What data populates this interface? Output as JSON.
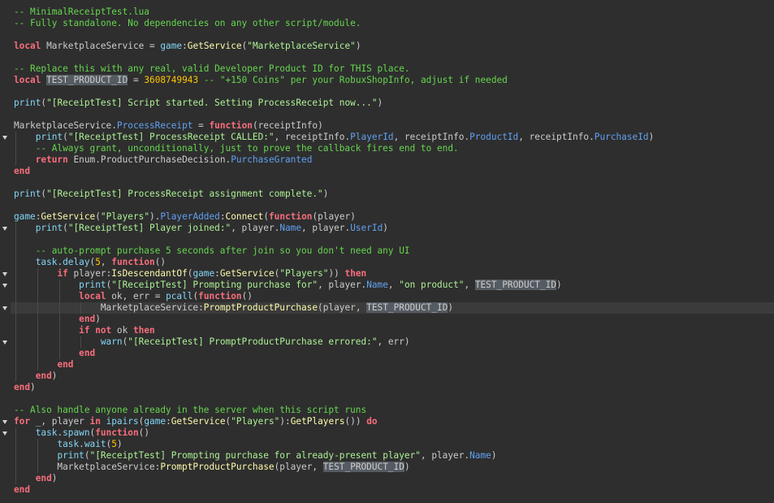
{
  "editor": {
    "language": "lua",
    "current_line_index": 26,
    "fold_markers": [
      11,
      19,
      23,
      24,
      26,
      29,
      36,
      37
    ],
    "lines": [
      [
        [
          "cm",
          "-- MinimalReceiptTest.lua"
        ]
      ],
      [
        [
          "cm",
          "-- Fully standalone. No dependencies on any other script/module."
        ]
      ],
      [],
      [
        [
          "kw",
          "local"
        ],
        [
          "id",
          " MarketplaceService "
        ],
        [
          "op",
          "="
        ],
        [
          "id",
          " "
        ],
        [
          "bi",
          "game"
        ],
        [
          "op",
          ":"
        ],
        [
          "fn",
          "GetService"
        ],
        [
          "op",
          "("
        ],
        [
          "st",
          "\"MarketplaceService\""
        ],
        [
          "op",
          ")"
        ]
      ],
      [],
      [
        [
          "cm",
          "-- Replace this with any real, valid Developer Product ID for THIS place."
        ]
      ],
      [
        [
          "kw",
          "local"
        ],
        [
          "id",
          " "
        ],
        [
          "hl",
          "TEST_PRODUCT_ID"
        ],
        [
          "id",
          " "
        ],
        [
          "op",
          "="
        ],
        [
          "id",
          " "
        ],
        [
          "nm",
          "3608749943"
        ],
        [
          "id",
          " "
        ],
        [
          "cm",
          "-- \"+150 Coins\" per your RobuxShopInfo, adjust if needed"
        ]
      ],
      [],
      [
        [
          "bi",
          "print"
        ],
        [
          "op",
          "("
        ],
        [
          "st",
          "\"[ReceiptTest] Script started. Setting ProcessReceipt now...\""
        ],
        [
          "op",
          ")"
        ]
      ],
      [],
      [
        [
          "id",
          "MarketplaceService"
        ],
        [
          "op",
          "."
        ],
        [
          "pr",
          "ProcessReceipt"
        ],
        [
          "id",
          " "
        ],
        [
          "op",
          "="
        ],
        [
          "id",
          " "
        ],
        [
          "kw",
          "function"
        ],
        [
          "op",
          "("
        ],
        [
          "id",
          "receiptInfo"
        ],
        [
          "op",
          ")"
        ]
      ],
      [
        [
          "id",
          "    "
        ],
        [
          "bi",
          "print"
        ],
        [
          "op",
          "("
        ],
        [
          "st",
          "\"[ReceiptTest] ProcessReceipt CALLED:\""
        ],
        [
          "op",
          ","
        ],
        [
          "id",
          " receiptInfo"
        ],
        [
          "op",
          "."
        ],
        [
          "pr",
          "PlayerId"
        ],
        [
          "op",
          ","
        ],
        [
          "id",
          " receiptInfo"
        ],
        [
          "op",
          "."
        ],
        [
          "pr",
          "ProductId"
        ],
        [
          "op",
          ","
        ],
        [
          "id",
          " receiptInfo"
        ],
        [
          "op",
          "."
        ],
        [
          "pr",
          "PurchaseId"
        ],
        [
          "op",
          ")"
        ]
      ],
      [
        [
          "id",
          "    "
        ],
        [
          "cm",
          "-- Always grant, unconditionally, just to prove the callback fires end to end."
        ]
      ],
      [
        [
          "id",
          "    "
        ],
        [
          "kw",
          "return"
        ],
        [
          "id",
          " Enum"
        ],
        [
          "op",
          "."
        ],
        [
          "id",
          "ProductPurchaseDecision"
        ],
        [
          "op",
          "."
        ],
        [
          "pr",
          "PurchaseGranted"
        ]
      ],
      [
        [
          "kw",
          "end"
        ]
      ],
      [],
      [
        [
          "bi",
          "print"
        ],
        [
          "op",
          "("
        ],
        [
          "st",
          "\"[ReceiptTest] ProcessReceipt assignment complete.\""
        ],
        [
          "op",
          ")"
        ]
      ],
      [],
      [
        [
          "bi",
          "game"
        ],
        [
          "op",
          ":"
        ],
        [
          "fn",
          "GetService"
        ],
        [
          "op",
          "("
        ],
        [
          "st",
          "\"Players\""
        ],
        [
          "op",
          ")."
        ],
        [
          "pr",
          "PlayerAdded"
        ],
        [
          "op",
          ":"
        ],
        [
          "fn",
          "Connect"
        ],
        [
          "op",
          "("
        ],
        [
          "kw",
          "function"
        ],
        [
          "op",
          "("
        ],
        [
          "id",
          "player"
        ],
        [
          "op",
          ")"
        ]
      ],
      [
        [
          "id",
          "    "
        ],
        [
          "bi",
          "print"
        ],
        [
          "op",
          "("
        ],
        [
          "st",
          "\"[ReceiptTest] Player joined:\""
        ],
        [
          "op",
          ","
        ],
        [
          "id",
          " player"
        ],
        [
          "op",
          "."
        ],
        [
          "pr",
          "Name"
        ],
        [
          "op",
          ","
        ],
        [
          "id",
          " player"
        ],
        [
          "op",
          "."
        ],
        [
          "pr",
          "UserId"
        ],
        [
          "op",
          ")"
        ]
      ],
      [],
      [
        [
          "id",
          "    "
        ],
        [
          "cm",
          "-- auto-prompt purchase 5 seconds after join so you don't need any UI"
        ]
      ],
      [
        [
          "id",
          "    "
        ],
        [
          "bi",
          "task"
        ],
        [
          "op",
          "."
        ],
        [
          "bi",
          "delay"
        ],
        [
          "op",
          "("
        ],
        [
          "nm",
          "5"
        ],
        [
          "op",
          ","
        ],
        [
          "id",
          " "
        ],
        [
          "kw",
          "function"
        ],
        [
          "op",
          "()"
        ]
      ],
      [
        [
          "id",
          "        "
        ],
        [
          "kw",
          "if"
        ],
        [
          "id",
          " player"
        ],
        [
          "op",
          ":"
        ],
        [
          "fn",
          "IsDescendantOf"
        ],
        [
          "op",
          "("
        ],
        [
          "bi",
          "game"
        ],
        [
          "op",
          ":"
        ],
        [
          "fn",
          "GetService"
        ],
        [
          "op",
          "("
        ],
        [
          "st",
          "\"Players\""
        ],
        [
          "op",
          "))"
        ],
        [
          "id",
          " "
        ],
        [
          "kw",
          "then"
        ]
      ],
      [
        [
          "id",
          "            "
        ],
        [
          "bi",
          "print"
        ],
        [
          "op",
          "("
        ],
        [
          "st",
          "\"[ReceiptTest] Prompting purchase for\""
        ],
        [
          "op",
          ","
        ],
        [
          "id",
          " player"
        ],
        [
          "op",
          "."
        ],
        [
          "pr",
          "Name"
        ],
        [
          "op",
          ","
        ],
        [
          "id",
          " "
        ],
        [
          "st",
          "\"on product\""
        ],
        [
          "op",
          ","
        ],
        [
          "id",
          " "
        ],
        [
          "hl",
          "TEST_PRODUCT_ID"
        ],
        [
          "op",
          ")"
        ]
      ],
      [
        [
          "id",
          "            "
        ],
        [
          "kw",
          "local"
        ],
        [
          "id",
          " ok"
        ],
        [
          "op",
          ","
        ],
        [
          "id",
          " err "
        ],
        [
          "op",
          "="
        ],
        [
          "id",
          " "
        ],
        [
          "bi",
          "pcall"
        ],
        [
          "op",
          "("
        ],
        [
          "kw",
          "function"
        ],
        [
          "op",
          "()"
        ]
      ],
      [
        [
          "id",
          "                MarketplaceService"
        ],
        [
          "op",
          ":"
        ],
        [
          "fn",
          "PromptProductPurchase"
        ],
        [
          "op",
          "("
        ],
        [
          "id",
          "player"
        ],
        [
          "op",
          ","
        ],
        [
          "id",
          " "
        ],
        [
          "hl",
          "TEST_PRODUCT_ID"
        ],
        [
          "op",
          ")"
        ]
      ],
      [
        [
          "id",
          "            "
        ],
        [
          "kw",
          "end"
        ],
        [
          "op",
          ")"
        ]
      ],
      [
        [
          "id",
          "            "
        ],
        [
          "kw",
          "if"
        ],
        [
          "id",
          " "
        ],
        [
          "kw",
          "not"
        ],
        [
          "id",
          " ok "
        ],
        [
          "kw",
          "then"
        ]
      ],
      [
        [
          "id",
          "                "
        ],
        [
          "bi",
          "warn"
        ],
        [
          "op",
          "("
        ],
        [
          "st",
          "\"[ReceiptTest] PromptProductPurchase errored:\""
        ],
        [
          "op",
          ","
        ],
        [
          "id",
          " err"
        ],
        [
          "op",
          ")"
        ]
      ],
      [
        [
          "id",
          "            "
        ],
        [
          "kw",
          "end"
        ]
      ],
      [
        [
          "id",
          "        "
        ],
        [
          "kw",
          "end"
        ]
      ],
      [
        [
          "id",
          "    "
        ],
        [
          "kw",
          "end"
        ],
        [
          "op",
          ")"
        ]
      ],
      [
        [
          "kw",
          "end"
        ],
        [
          "op",
          ")"
        ]
      ],
      [],
      [
        [
          "cm",
          "-- Also handle anyone already in the server when this script runs"
        ]
      ],
      [
        [
          "kw",
          "for"
        ],
        [
          "id",
          " _"
        ],
        [
          "op",
          ","
        ],
        [
          "id",
          " player "
        ],
        [
          "kw",
          "in"
        ],
        [
          "id",
          " "
        ],
        [
          "bi",
          "ipairs"
        ],
        [
          "op",
          "("
        ],
        [
          "bi",
          "game"
        ],
        [
          "op",
          ":"
        ],
        [
          "fn",
          "GetService"
        ],
        [
          "op",
          "("
        ],
        [
          "st",
          "\"Players\""
        ],
        [
          "op",
          "):"
        ],
        [
          "fn",
          "GetPlayers"
        ],
        [
          "op",
          "())"
        ],
        [
          "id",
          " "
        ],
        [
          "kw",
          "do"
        ]
      ],
      [
        [
          "id",
          "    "
        ],
        [
          "bi",
          "task"
        ],
        [
          "op",
          "."
        ],
        [
          "bi",
          "spawn"
        ],
        [
          "op",
          "("
        ],
        [
          "kw",
          "function"
        ],
        [
          "op",
          "()"
        ]
      ],
      [
        [
          "id",
          "        "
        ],
        [
          "bi",
          "task"
        ],
        [
          "op",
          "."
        ],
        [
          "bi",
          "wait"
        ],
        [
          "op",
          "("
        ],
        [
          "nm",
          "5"
        ],
        [
          "op",
          ")"
        ]
      ],
      [
        [
          "id",
          "        "
        ],
        [
          "bi",
          "print"
        ],
        [
          "op",
          "("
        ],
        [
          "st",
          "\"[ReceiptTest] Prompting purchase for already-present player\""
        ],
        [
          "op",
          ","
        ],
        [
          "id",
          " player"
        ],
        [
          "op",
          "."
        ],
        [
          "pr",
          "Name"
        ],
        [
          "op",
          ")"
        ]
      ],
      [
        [
          "id",
          "        MarketplaceService"
        ],
        [
          "op",
          ":"
        ],
        [
          "fn",
          "PromptProductPurchase"
        ],
        [
          "op",
          "("
        ],
        [
          "id",
          "player"
        ],
        [
          "op",
          ","
        ],
        [
          "id",
          " "
        ],
        [
          "hl",
          "TEST_PRODUCT_ID"
        ],
        [
          "op",
          ")"
        ]
      ],
      [
        [
          "id",
          "    "
        ],
        [
          "kw",
          "end"
        ],
        [
          "op",
          ")"
        ]
      ],
      [
        [
          "kw",
          "end"
        ]
      ]
    ]
  }
}
